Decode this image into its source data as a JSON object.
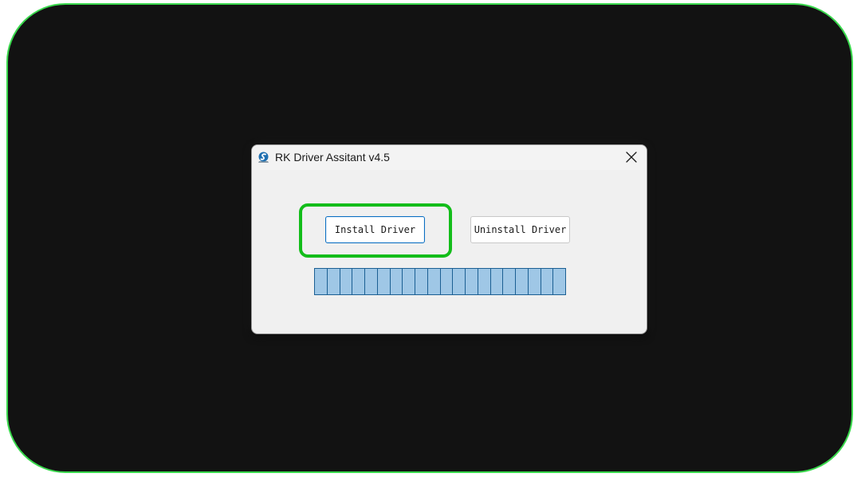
{
  "dialog": {
    "title": "RK Driver Assitant v4.5",
    "icons": {
      "app": "app-logo-icon",
      "close": "close-icon"
    }
  },
  "buttons": {
    "install_label": "Install Driver",
    "uninstall_label": "Uninstall Driver"
  },
  "progress": {
    "segments": 20,
    "fraction": 1.0
  },
  "colors": {
    "highlight": "#13bd1a",
    "frame_border": "#39d84c",
    "background": "#121212",
    "progress_fill": "#9fc7e6",
    "progress_border": "#1b5f93",
    "focus_border": "#0a6fc2"
  }
}
